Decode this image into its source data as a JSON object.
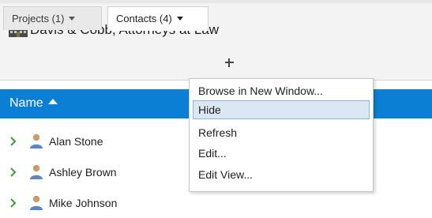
{
  "header": {
    "org_name": "Davis & Cobb, Attorneys at Law",
    "icon": "building-icon"
  },
  "tabs": [
    {
      "label": "Projects (1)",
      "active": false
    },
    {
      "label": "Contacts (4)",
      "active": true
    }
  ],
  "add_tab_icon": "plus-icon",
  "grid": {
    "column_name": "Name",
    "sort": "ascending",
    "rows": [
      {
        "name": "Alan Stone"
      },
      {
        "name": "Ashley Brown"
      },
      {
        "name": "Mike Johnson"
      }
    ]
  },
  "context_menu": {
    "items": [
      {
        "label": "Browse in New Window..."
      },
      {
        "label": "Hide",
        "highlighted": true
      },
      {
        "label": "Refresh"
      },
      {
        "label": "Edit..."
      },
      {
        "label": "Edit View..."
      }
    ]
  },
  "colors": {
    "accent": "#0b7fd3",
    "expander_green": "#3d9a3d",
    "menu_highlight": "#dbe8f4"
  }
}
